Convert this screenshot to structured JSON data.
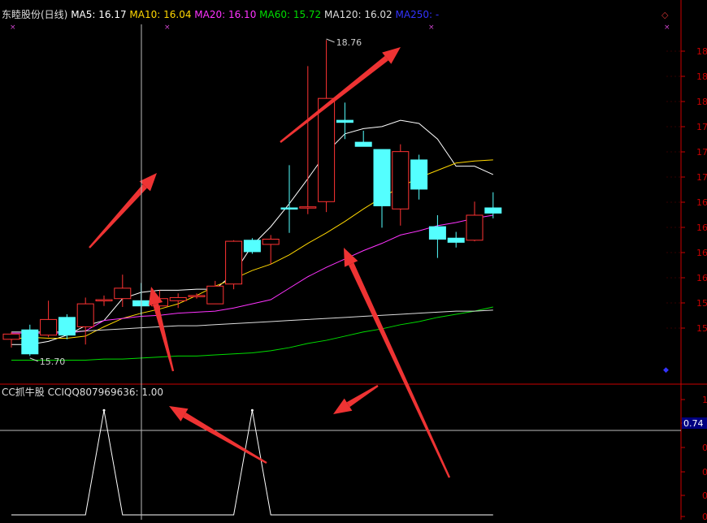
{
  "header": {
    "stock_title": "东睦股份(日线)",
    "ma_items": [
      {
        "label": "MA5: 16.17",
        "color": "#ffffff"
      },
      {
        "label": "MA10: 16.04",
        "color": "#ffd700"
      },
      {
        "label": "MA20: 16.10",
        "color": "#ff33ff"
      },
      {
        "label": "MA60: 15.72",
        "color": "#00dd00"
      },
      {
        "label": "MA120: 16.02",
        "color": "#dddddd"
      },
      {
        "label": "MA250: -",
        "color": "#3333ff"
      }
    ]
  },
  "indicator": {
    "title": "CC抓牛股",
    "value_label": "CCIQQ807969636: 1.00",
    "current_value_box": "0.74"
  },
  "colors": {
    "up": "#ff3333",
    "down": "#54ffff",
    "axis": "#cc0000",
    "arrow": "#ee3333",
    "crosshair": "#bbbbbb"
  },
  "chart_data": [
    {
      "type": "candlestick",
      "annotations": [
        {
          "text": "18.76",
          "index": 17,
          "value": 18.76
        },
        {
          "text": "15.70",
          "index": 1,
          "value": 15.7
        }
      ],
      "y_tick_labels": [
        "18",
        "18",
        "18",
        "17",
        "17",
        "17",
        "16",
        "16",
        "16",
        "16",
        "15",
        "15"
      ],
      "ylim": [
        15.45,
        18.9
      ],
      "candles": [
        {
          "o": 15.88,
          "h": 15.95,
          "l": 15.8,
          "c": 15.93
        },
        {
          "o": 15.97,
          "h": 16.02,
          "l": 15.72,
          "c": 15.74
        },
        {
          "o": 15.92,
          "h": 16.25,
          "l": 15.9,
          "c": 16.07
        },
        {
          "o": 16.09,
          "h": 16.12,
          "l": 15.88,
          "c": 15.92
        },
        {
          "o": 16.0,
          "h": 16.28,
          "l": 15.83,
          "c": 16.22
        },
        {
          "o": 16.26,
          "h": 16.3,
          "l": 16.2,
          "c": 16.26
        },
        {
          "o": 16.27,
          "h": 16.5,
          "l": 16.19,
          "c": 16.37
        },
        {
          "o": 16.25,
          "h": 16.42,
          "l": 16.11,
          "c": 16.2
        },
        {
          "o": 16.2,
          "h": 16.35,
          "l": 16.1,
          "c": 16.27
        },
        {
          "o": 16.25,
          "h": 16.32,
          "l": 16.18,
          "c": 16.28
        },
        {
          "o": 16.3,
          "h": 16.32,
          "l": 16.27,
          "c": 16.3
        },
        {
          "o": 16.22,
          "h": 16.44,
          "l": 16.22,
          "c": 16.39
        },
        {
          "o": 16.41,
          "h": 16.83,
          "l": 16.36,
          "c": 16.82
        },
        {
          "o": 16.83,
          "h": 16.85,
          "l": 16.7,
          "c": 16.72
        },
        {
          "o": 16.79,
          "h": 16.88,
          "l": 16.6,
          "c": 16.84
        },
        {
          "o": 17.14,
          "h": 17.55,
          "l": 16.9,
          "c": 17.13
        },
        {
          "o": 17.15,
          "h": 18.5,
          "l": 17.08,
          "c": 17.15
        },
        {
          "o": 17.2,
          "h": 18.75,
          "l": 17.1,
          "c": 18.19
        },
        {
          "o": 17.98,
          "h": 18.15,
          "l": 17.8,
          "c": 17.96
        },
        {
          "o": 17.77,
          "h": 17.88,
          "l": 17.73,
          "c": 17.73
        },
        {
          "o": 17.7,
          "h": 17.7,
          "l": 16.95,
          "c": 17.16
        },
        {
          "o": 17.13,
          "h": 17.75,
          "l": 16.97,
          "c": 17.68
        },
        {
          "o": 17.6,
          "h": 17.65,
          "l": 17.22,
          "c": 17.32
        },
        {
          "o": 16.96,
          "h": 17.07,
          "l": 16.66,
          "c": 16.84
        },
        {
          "o": 16.85,
          "h": 16.91,
          "l": 16.76,
          "c": 16.81
        },
        {
          "o": 16.83,
          "h": 17.2,
          "l": 16.82,
          "c": 17.07
        },
        {
          "o": 17.14,
          "h": 17.29,
          "l": 17.04,
          "c": 17.09
        }
      ],
      "ma_lines": [
        {
          "name": "MA5",
          "color": "#ffffff",
          "values": [
            15.83,
            15.83,
            15.86,
            15.92,
            16.01,
            16.06,
            16.27,
            16.33,
            16.35,
            16.35,
            16.36,
            16.36,
            16.51,
            16.78,
            16.96,
            17.18,
            17.42,
            17.67,
            17.85,
            17.9,
            17.92,
            17.98,
            17.95,
            17.8,
            17.54,
            17.54,
            17.46
          ]
        },
        {
          "name": "MA10",
          "color": "#ffd700",
          "values": [
            15.88,
            15.9,
            15.89,
            15.89,
            15.91,
            16.0,
            16.08,
            16.13,
            16.17,
            16.22,
            16.3,
            16.39,
            16.46,
            16.54,
            16.6,
            16.69,
            16.8,
            16.9,
            17.01,
            17.13,
            17.24,
            17.34,
            17.43,
            17.5,
            17.57,
            17.59,
            17.6
          ]
        },
        {
          "name": "MA20",
          "color": "#ff33ff",
          "values": [
            15.94,
            15.94,
            15.94,
            15.94,
            15.96,
            16.06,
            16.08,
            16.1,
            16.11,
            16.13,
            16.14,
            16.15,
            16.18,
            16.22,
            16.26,
            16.37,
            16.48,
            16.57,
            16.65,
            16.73,
            16.8,
            16.88,
            16.92,
            16.97,
            17.0,
            17.04,
            17.07
          ]
        },
        {
          "name": "MA60",
          "color": "#00dd00",
          "values": [
            15.68,
            15.68,
            15.68,
            15.68,
            15.68,
            15.69,
            15.69,
            15.7,
            15.71,
            15.72,
            15.72,
            15.73,
            15.74,
            15.75,
            15.77,
            15.8,
            15.84,
            15.87,
            15.91,
            15.95,
            15.98,
            16.02,
            16.05,
            16.09,
            16.12,
            16.15,
            16.19
          ]
        },
        {
          "name": "MA120",
          "color": "#dddddd",
          "values": [
            15.95,
            15.95,
            15.95,
            15.95,
            15.96,
            15.97,
            15.98,
            15.99,
            16.0,
            16.01,
            16.01,
            16.02,
            16.03,
            16.04,
            16.05,
            16.06,
            16.07,
            16.08,
            16.09,
            16.1,
            16.11,
            16.12,
            16.13,
            16.14,
            16.15,
            16.15,
            16.16
          ]
        }
      ]
    },
    {
      "type": "line",
      "title": "CC抓牛股",
      "series": [
        {
          "name": "CCIQQ807969636",
          "color": "#ffffff",
          "values": [
            0,
            0,
            0,
            0,
            0,
            1,
            0,
            0,
            0,
            0,
            0,
            0,
            0,
            1,
            0,
            0,
            0,
            0,
            0,
            0,
            0,
            0,
            0,
            0,
            0,
            0,
            0
          ]
        }
      ],
      "y_tick_labels": [
        "1",
        "1",
        "0",
        "0",
        "0",
        "0"
      ],
      "ylim": [
        0,
        1.15
      ]
    }
  ]
}
